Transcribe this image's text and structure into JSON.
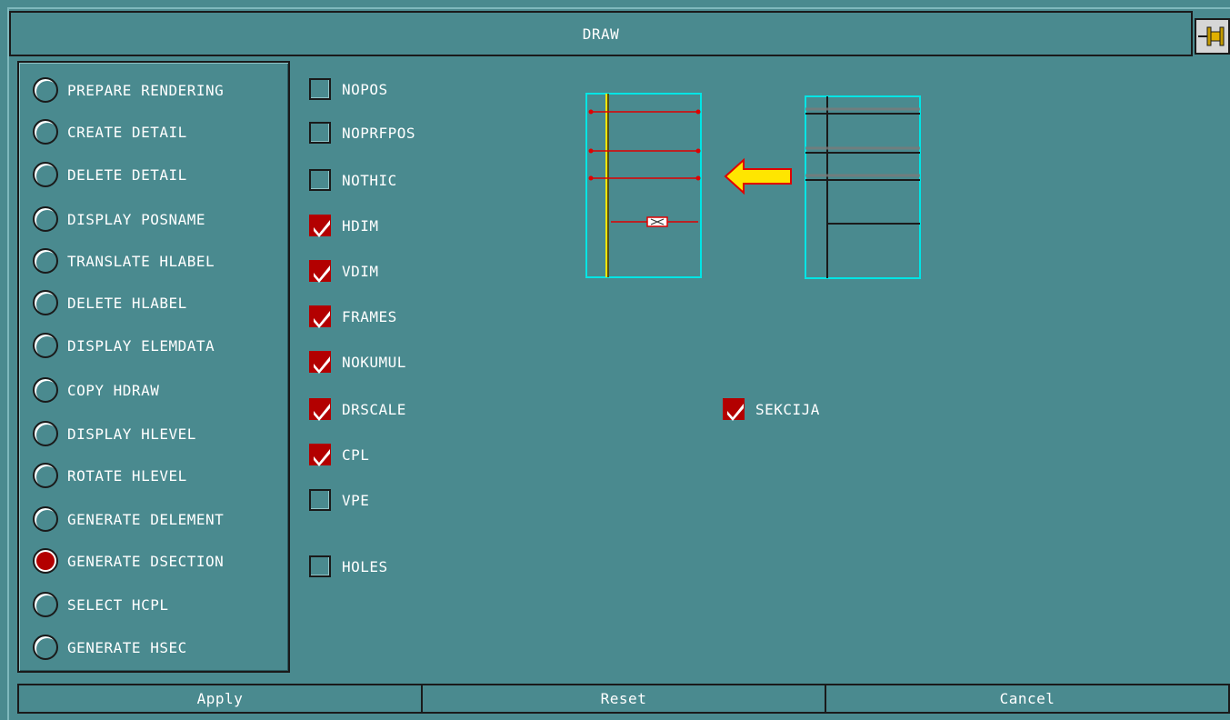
{
  "window": {
    "title": "DRAW"
  },
  "colors": {
    "background": "#4a8a8f",
    "accent_red": "#b30000",
    "outline_cyan": "#00e5e5",
    "arrow_yellow": "#ffe600"
  },
  "radio_options": [
    {
      "label": "PREPARE RENDERING",
      "selected": false
    },
    {
      "label": "CREATE DETAIL",
      "selected": false
    },
    {
      "label": "DELETE DETAIL",
      "selected": false
    },
    {
      "label": "DISPLAY POSNAME",
      "selected": false
    },
    {
      "label": "TRANSLATE HLABEL",
      "selected": false
    },
    {
      "label": "DELETE HLABEL",
      "selected": false
    },
    {
      "label": "DISPLAY ELEMDATA",
      "selected": false
    },
    {
      "label": "COPY HDRAW",
      "selected": false
    },
    {
      "label": "DISPLAY HLEVEL",
      "selected": false
    },
    {
      "label": "ROTATE HLEVEL",
      "selected": false
    },
    {
      "label": "GENERATE DELEMENT",
      "selected": false
    },
    {
      "label": "GENERATE DSECTION",
      "selected": true
    },
    {
      "label": "SELECT HCPL",
      "selected": false
    },
    {
      "label": "GENERATE HSEC",
      "selected": false
    }
  ],
  "checkboxes": [
    {
      "label": "NOPOS",
      "checked": false
    },
    {
      "label": "NOPRFPOS",
      "checked": false
    },
    {
      "label": "NOTHIC",
      "checked": false
    },
    {
      "label": "HDIM",
      "checked": true
    },
    {
      "label": "VDIM",
      "checked": true
    },
    {
      "label": "FRAMES",
      "checked": true
    },
    {
      "label": "NOKUMUL",
      "checked": true
    },
    {
      "label": "DRSCALE",
      "checked": true
    },
    {
      "label": "CPL",
      "checked": true
    },
    {
      "label": "VPE",
      "checked": false
    },
    {
      "label": "HOLES",
      "checked": false
    }
  ],
  "sekcija": {
    "label": "SEKCIJA",
    "checked": true
  },
  "footer": {
    "apply": "Apply",
    "reset": "Reset",
    "cancel": "Cancel"
  }
}
